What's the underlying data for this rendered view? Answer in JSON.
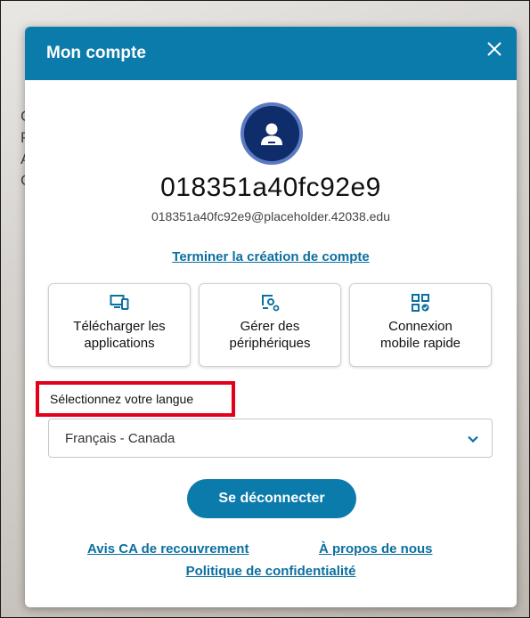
{
  "background": {
    "letters": [
      "C",
      "P",
      "A",
      "C"
    ]
  },
  "dialog": {
    "title": "Mon compte",
    "close_icon": "close-icon",
    "accent_color": "#0b7bac",
    "user": {
      "avatar_icon": "user-avatar-icon",
      "username": "018351a40fc92e9",
      "email": "018351a40fc92e9@placeholder.42038.edu"
    },
    "finish_account_link": "Terminer la création de compte",
    "tiles": [
      {
        "icon": "monitor-phone-icon",
        "label": "Télécharger les\napplications"
      },
      {
        "icon": "device-settings-icon",
        "label": "Gérer des\npériphériques"
      },
      {
        "icon": "qr-code-icon",
        "label": "Connexion\nmobile rapide"
      }
    ],
    "language": {
      "label": "Sélectionnez votre langue",
      "selected": "Français - Canada",
      "highlight_color": "#e3001b"
    },
    "logout_button": "Se déconnecter",
    "footer_links": {
      "avis": "Avis CA de recouvrement",
      "apropos": "À propos de nous",
      "politique": "Politique de confidentialité"
    }
  }
}
